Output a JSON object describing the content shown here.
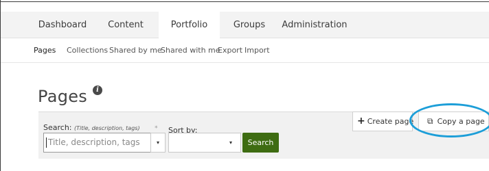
{
  "topnav": {
    "tabs": [
      {
        "label": "Dashboard"
      },
      {
        "label": "Content"
      },
      {
        "label": "Portfolio"
      },
      {
        "label": "Groups"
      },
      {
        "label": "Administration"
      }
    ],
    "active": "Portfolio"
  },
  "subnav": {
    "items": [
      {
        "label": "Pages"
      },
      {
        "label": "Collections"
      },
      {
        "label": "Shared by me"
      },
      {
        "label": "Shared with me"
      },
      {
        "label": "Export"
      },
      {
        "label": "Import"
      }
    ],
    "active": "Pages"
  },
  "page": {
    "title": "Pages",
    "info_icon": "info-icon"
  },
  "search": {
    "label": "Search:",
    "hint": "(Title, description, tags)",
    "asterisk": "*",
    "placeholder": "Title, description, tags",
    "sort_label": "Sort by:",
    "button_label": "Search",
    "dropdown_arrow": "▾"
  },
  "actions": {
    "create_label": "Create page",
    "copy_label": "Copy a page",
    "create_icon": "plus-icon",
    "copy_icon": "copy-icon"
  },
  "colors": {
    "search_button": "#3e6c12",
    "highlight": "#1c9ed8"
  }
}
